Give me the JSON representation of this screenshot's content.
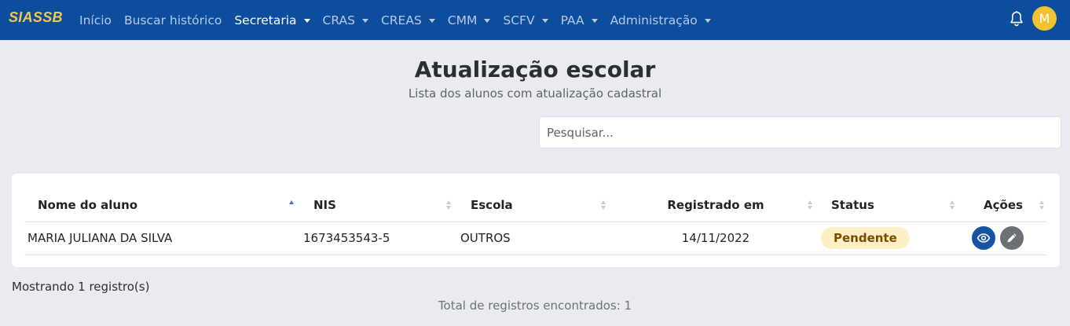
{
  "navbar": {
    "brand": "SIASSB",
    "items": [
      {
        "label": "Início",
        "has_dropdown": false,
        "active": false
      },
      {
        "label": "Buscar histórico",
        "has_dropdown": false,
        "active": false
      },
      {
        "label": "Secretaria",
        "has_dropdown": true,
        "active": true
      },
      {
        "label": "CRAS",
        "has_dropdown": true,
        "active": false
      },
      {
        "label": "CREAS",
        "has_dropdown": true,
        "active": false
      },
      {
        "label": "CMM",
        "has_dropdown": true,
        "active": false
      },
      {
        "label": "SCFV",
        "has_dropdown": true,
        "active": false
      },
      {
        "label": "PAA",
        "has_dropdown": true,
        "active": false
      },
      {
        "label": "Administração",
        "has_dropdown": true,
        "active": false
      }
    ],
    "notification_icon": "bell-icon",
    "avatar_initial": "M"
  },
  "page": {
    "title": "Atualização escolar",
    "subtitle": "Lista dos alunos com atualização cadastral"
  },
  "search": {
    "placeholder": "Pesquisar...",
    "value": ""
  },
  "table": {
    "columns": [
      {
        "label": "Nome do aluno",
        "sort": "asc"
      },
      {
        "label": "NIS",
        "sort": "none"
      },
      {
        "label": "Escola",
        "sort": "none"
      },
      {
        "label": "Registrado em",
        "sort": "none"
      },
      {
        "label": "Status",
        "sort": "none"
      },
      {
        "label": "Ações",
        "sort": "none"
      }
    ],
    "rows": [
      {
        "nome": "MARIA JULIANA DA SILVA",
        "nis": "1673453543-5",
        "escola": "OUTROS",
        "registrado": "14/11/2022",
        "status": "Pendente"
      }
    ],
    "actions": [
      "eye-icon",
      "pencil-icon"
    ]
  },
  "footer": {
    "showing": "Mostrando 1 registro(s)",
    "total": "Total de registros encontrados: 1"
  },
  "colors": {
    "navbar": "#0d4d9e",
    "brand": "#f2c94c",
    "avatar": "#f2c230",
    "status_pendente_bg": "#fdf0c4",
    "view_button": "#1653a3",
    "edit_button": "#6c7074"
  }
}
